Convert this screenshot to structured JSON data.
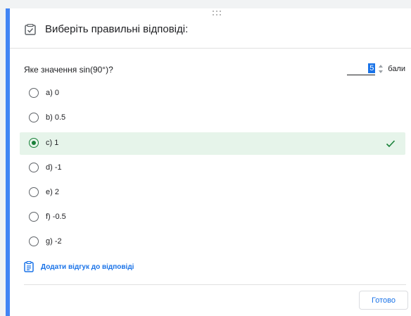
{
  "header": {
    "title": "Виберіть правильні відповіді:",
    "icon": "checkbox-checked-icon"
  },
  "question": {
    "text": "Яке значення sin(90°)?",
    "points_value": "5",
    "points_label": "бали"
  },
  "options": [
    {
      "label": "a) 0",
      "checked": false
    },
    {
      "label": "b) 0.5",
      "checked": false
    },
    {
      "label": "c) 1",
      "checked": true
    },
    {
      "label": "d) -1",
      "checked": false
    },
    {
      "label": "e) 2",
      "checked": false
    },
    {
      "label": "f) -0.5",
      "checked": false
    },
    {
      "label": "g) -2",
      "checked": false
    }
  ],
  "feedback": {
    "label": "Додати відгук до відповіді",
    "icon": "assignment-icon"
  },
  "done_label": "Готово",
  "colors": {
    "accent": "#4285f4",
    "link": "#1a73e8",
    "correct_bg": "#e6f4ea",
    "correct": "#188038"
  }
}
